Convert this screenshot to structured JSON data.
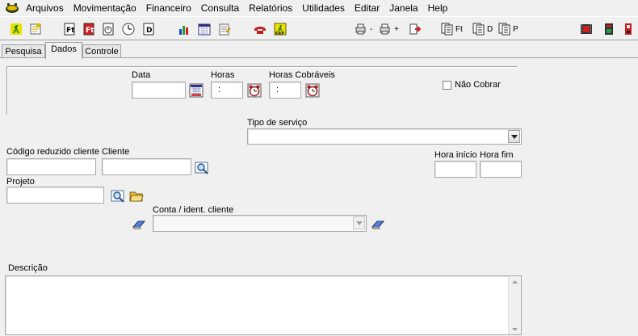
{
  "menu": {
    "items": [
      "Arquivos",
      "Movimentação",
      "Financeiro",
      "Consulta",
      "Relatórios",
      "Utilidades",
      "Editar",
      "Janela",
      "Help"
    ]
  },
  "toolbar": {
    "ft_label": "Ft",
    "d_label": "D",
    "p_label": "P"
  },
  "tabs": [
    "Pesquisa",
    "Dados",
    "Controle"
  ],
  "form": {
    "data_label": "Data",
    "horas_label": "Horas",
    "horas_value": ":",
    "horas_cobraveis_label": "Horas Cobráveis",
    "horas_cobraveis_value": ":",
    "nao_cobrar_label": "Não Cobrar",
    "tipo_servico_label": "Tipo de serviço",
    "codigo_cliente_label": "Código reduzido cliente",
    "cliente_label": "Cliente",
    "hora_inicio_label": "Hora início",
    "hora_fim_label": "Hora fim",
    "projeto_label": "Projeto",
    "conta_label": "Conta / ident. cliente",
    "descricao_label": "Descrição"
  },
  "colors": {
    "background": "#f0f0f0",
    "field_border": "#a9a9a9"
  }
}
